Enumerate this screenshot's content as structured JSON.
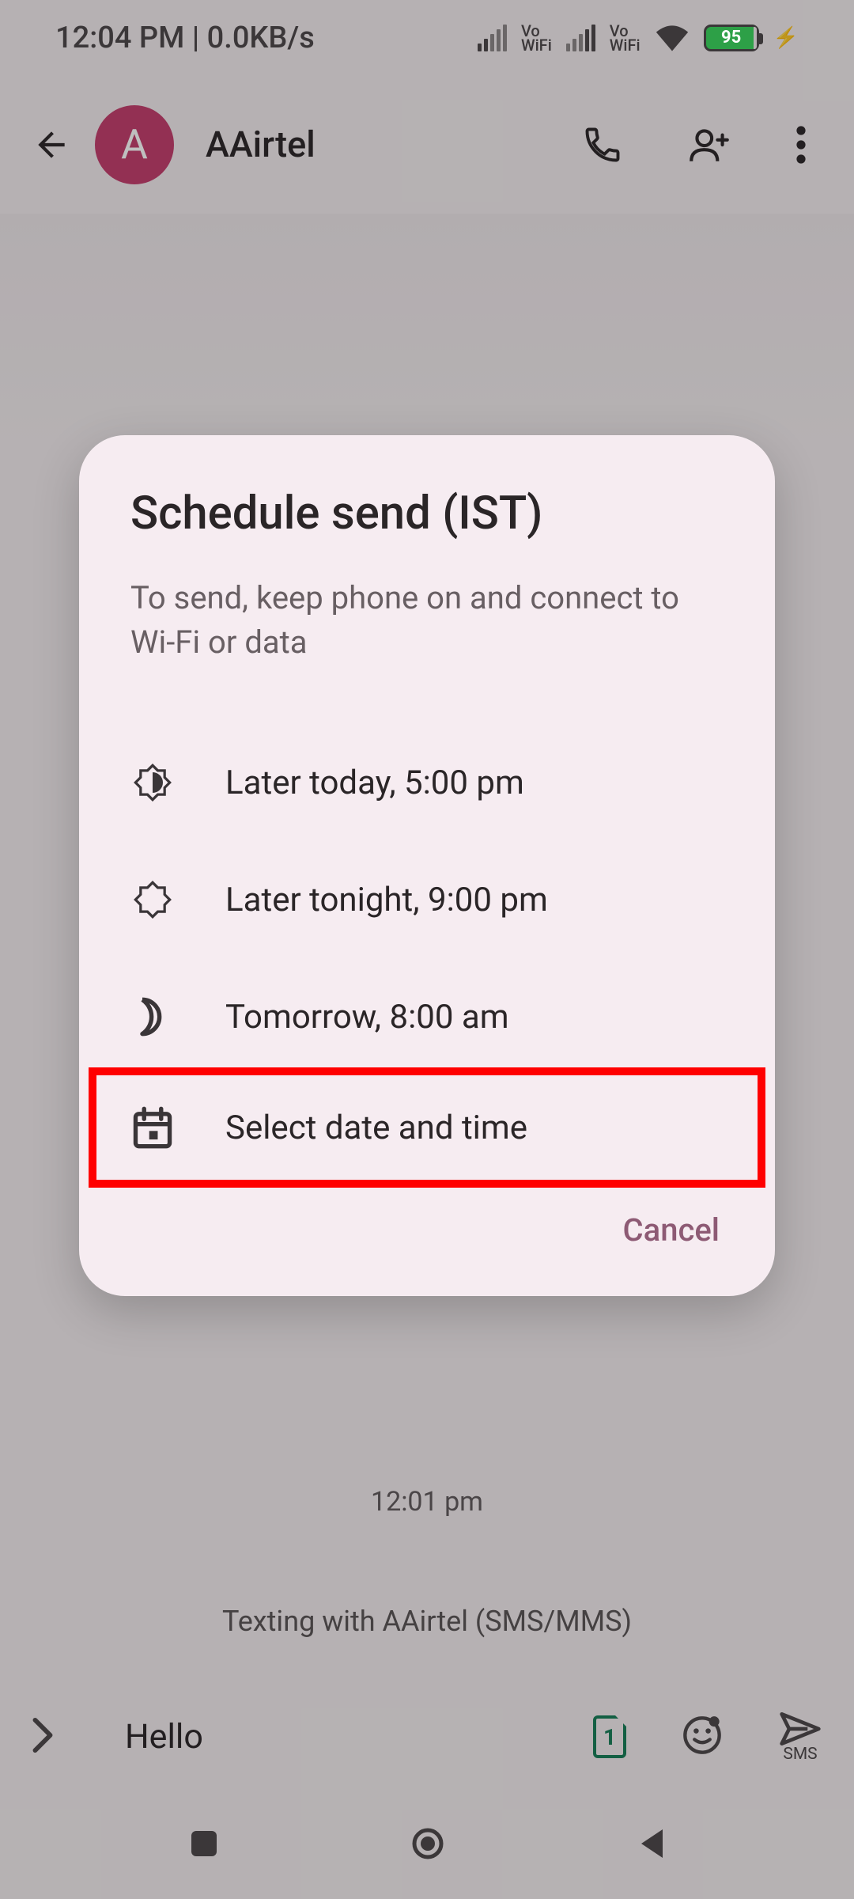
{
  "status_bar": {
    "time_data": "12:04 PM | 0.0KB/s",
    "vowifi": "Vo\nWiFi",
    "battery": "95"
  },
  "app_bar": {
    "avatar_letter": "A",
    "contact_name": "AAirtel"
  },
  "conversation": {
    "timestamp": "12:01 pm",
    "texting_with": "Texting with AAirtel (SMS/MMS)"
  },
  "compose": {
    "text": "Hello",
    "sim_number": "1",
    "send_label": "SMS"
  },
  "dialog": {
    "title": "Schedule send (IST)",
    "subtitle": "To send, keep phone on and connect to Wi-Fi or data",
    "options": [
      "Later today, 5:00 pm",
      "Later tonight, 9:00 pm",
      "Tomorrow, 8:00 am",
      "Select date and time"
    ],
    "cancel": "Cancel"
  }
}
